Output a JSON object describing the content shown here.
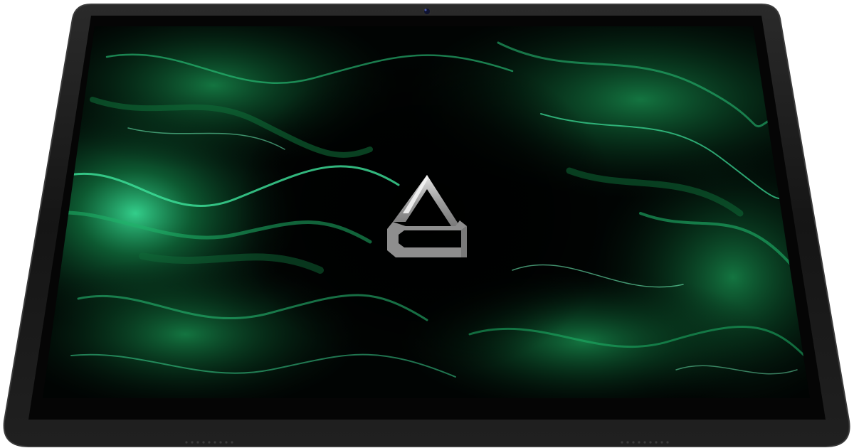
{
  "device": {
    "kind": "tablet",
    "orientation": "landscape",
    "frame_color": "#1b1b1b",
    "bezel_color": "#050505",
    "edge_highlight_color": "#3a3a3a",
    "camera_color": "#0f1330",
    "speaker_color": "#3c3c3c"
  },
  "screen": {
    "state": "boot-splash",
    "wallpaper": {
      "description_icon": "green-liquid-swirl-wallpaper",
      "base_color": "#000000",
      "dark_green": "#07331c",
      "mid_green": "#0f6a37",
      "bright_green": "#2fd38a",
      "highlight_color": "#6ff2b8"
    },
    "logo": {
      "icon": "brand-logo-icon",
      "color": "#8e8e8e",
      "top_color": "#d9d9d9",
      "text": ""
    }
  }
}
